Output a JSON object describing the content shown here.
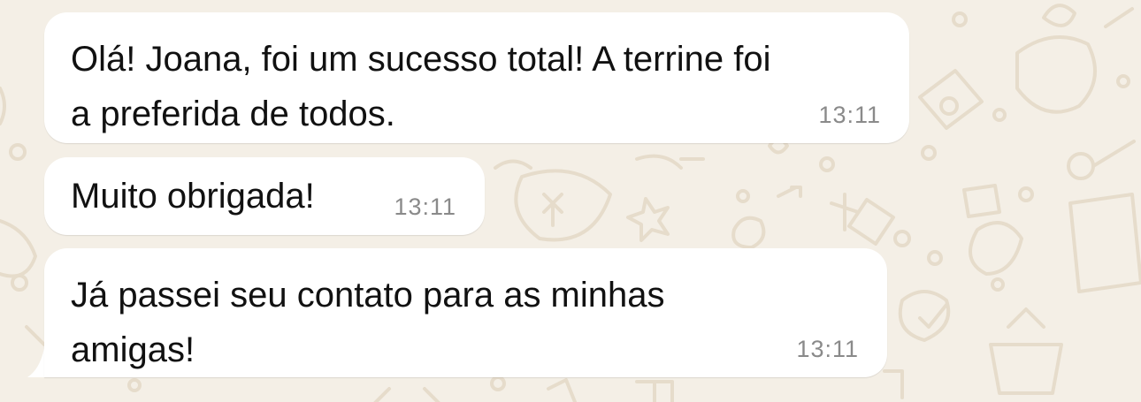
{
  "conversation": {
    "messages": [
      {
        "text": "Olá! Joana, foi um sucesso total! A terrine foi\na preferida de todos.",
        "time": "13:11"
      },
      {
        "text": "Muito obrigada!",
        "time": "13:11"
      },
      {
        "text": "Já passei seu contato para as minhas\namigas!",
        "time": "13:11"
      }
    ]
  },
  "colors": {
    "wallpaper": "#f4efe6",
    "doodle": "#e6dccb",
    "bubble": "#ffffff",
    "message_text": "#111111",
    "timestamp": "#8a8a8a"
  }
}
